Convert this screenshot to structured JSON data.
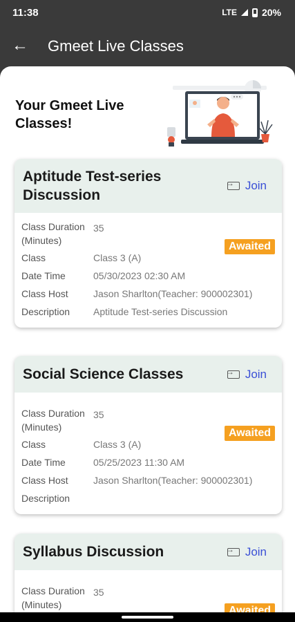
{
  "status_bar": {
    "time": "11:38",
    "network": "LTE",
    "battery": "20%"
  },
  "app_bar": {
    "back_icon": "arrow-back-icon",
    "title": "Gmeet Live Classes"
  },
  "hero": {
    "title": "Your Gmeet Live Classes!",
    "illustration": "teacher-laptop-illustration"
  },
  "labels": {
    "duration": "Class Duration (Minutes)",
    "class": "Class",
    "date_time": "Date Time",
    "host": "Class Host",
    "description": "Description",
    "join": "Join"
  },
  "classes": [
    {
      "title": "Aptitude Test-series Discussion",
      "duration": "35",
      "status": "Awaited",
      "class": "Class 3 (A)",
      "date_time": "05/30/2023 02:30 AM",
      "host": "Jason Sharlton(Teacher: 900002301)",
      "description": "Aptitude Test-series Discussion"
    },
    {
      "title": "Social Science Classes",
      "duration": "35",
      "status": "Awaited",
      "class": "Class 3 (A)",
      "date_time": "05/25/2023 11:30 AM",
      "host": "Jason Sharlton(Teacher: 900002301)",
      "description": ""
    },
    {
      "title": "Syllabus Discussion",
      "duration": "35",
      "status": "Awaited"
    }
  ],
  "colors": {
    "app_bar": "#3a3a3a",
    "card_header": "#e8f0ec",
    "join": "#3a4fd6",
    "badge": "#f5a020"
  }
}
